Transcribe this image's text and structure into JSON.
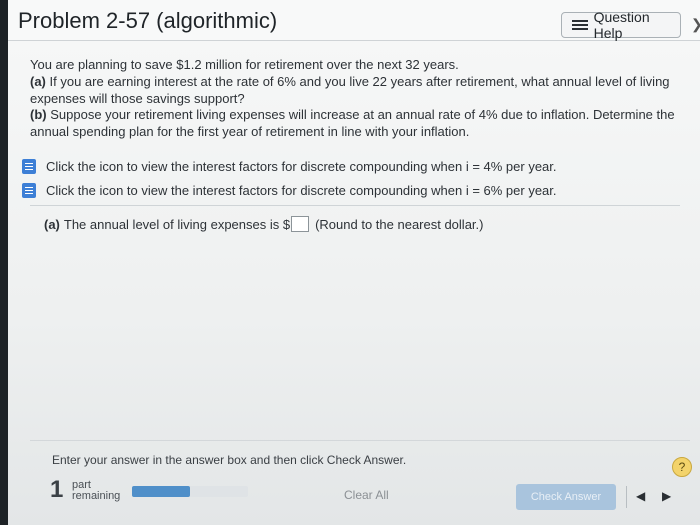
{
  "header": {
    "title": "Problem 2-57 (algorithmic)",
    "question_help_label": "Question Help",
    "question_help_icon": "list-icon"
  },
  "problem": {
    "intro": "You are planning to save $1.2 million for retirement over the next 32 years.",
    "part_a_label": "(a)",
    "part_a_text": "If you are earning interest at the rate of 6% and you live 22 years after retirement, what annual level of living expenses will those savings support?",
    "part_b_label": "(b)",
    "part_b_text": "Suppose your retirement living expenses will increase at an annual rate of 4% due to inflation. Determine the annual spending plan for the first year of retirement in line with your inflation."
  },
  "resources": [
    {
      "icon": "book-icon",
      "text": "Click the icon to view the interest factors for discrete compounding when i = 4% per year."
    },
    {
      "icon": "book-icon",
      "text": "Click the icon to view the interest factors for discrete compounding when i = 6% per year."
    }
  ],
  "answer": {
    "part_label": "(a)",
    "prompt": "The annual level of living expenses is $",
    "value": "",
    "hint": "(Round to the nearest dollar.)"
  },
  "footer": {
    "instructions": "Enter your answer in the answer box and then click Check Answer.",
    "help_symbol": "?",
    "parts_remaining_count": "1",
    "parts_remaining_label_1": "part",
    "parts_remaining_label_2": "remaining",
    "progress_fraction": 0.5,
    "clear_all_label": "Clear All",
    "check_answer_label": "Check Answer",
    "prev_symbol": "◀",
    "next_symbol": "▶"
  },
  "colors": {
    "accent": "#4f8fc9",
    "book_icon": "#3d7fd6",
    "help_circle": "#f3d36b"
  }
}
